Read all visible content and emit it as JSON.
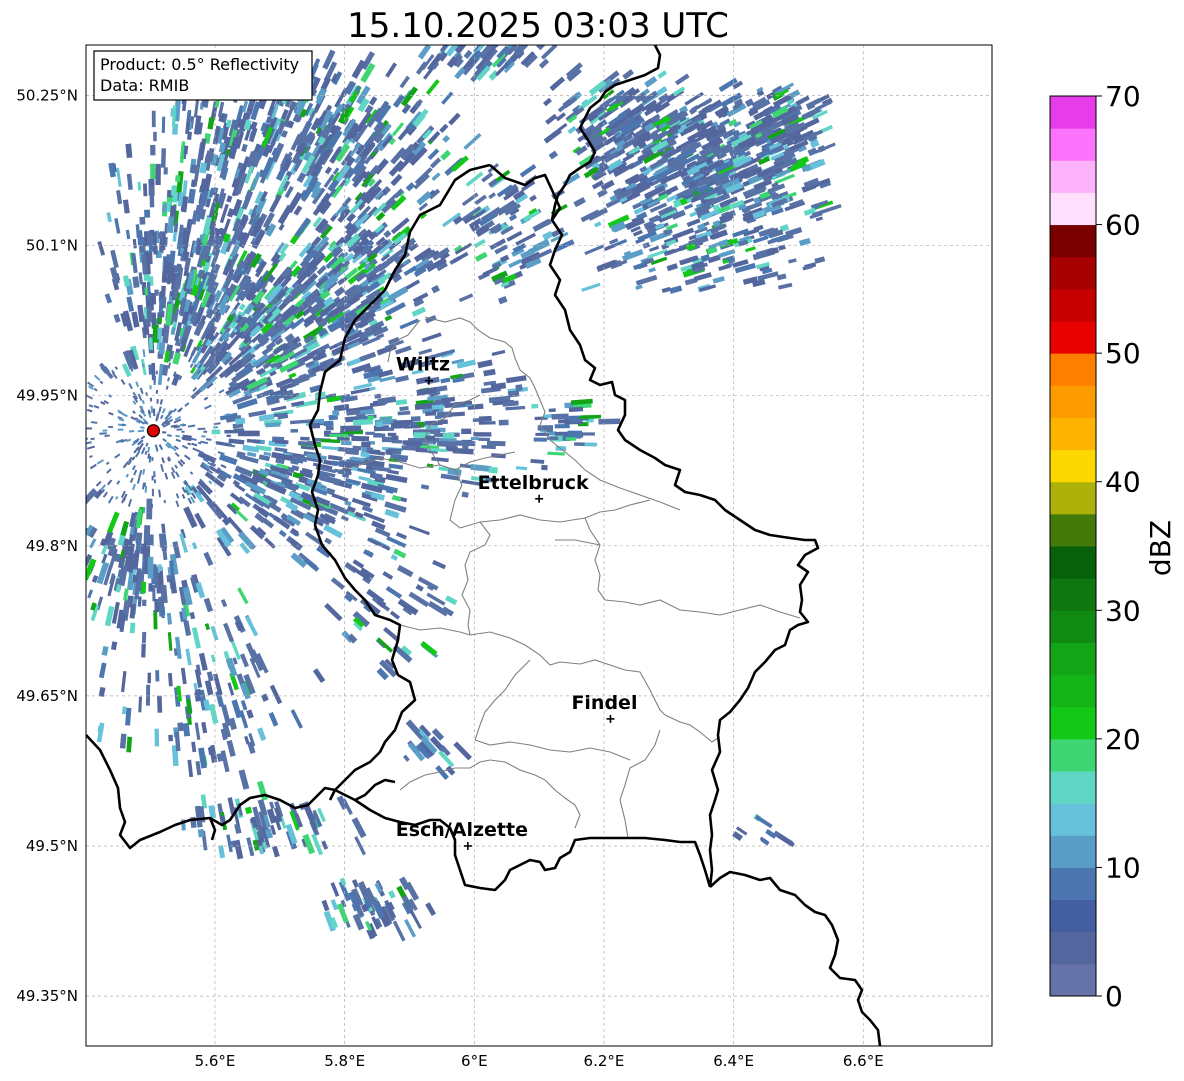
{
  "title": "15.10.2025 03:03 UTC",
  "info_box": {
    "line1": "Product: 0.5° Reflectivity",
    "line2": "Data: RMIB"
  },
  "lat_labels": [
    {
      "value": 50.25,
      "text": "50.25°N"
    },
    {
      "value": 50.1,
      "text": "50.1°N"
    },
    {
      "value": 49.95,
      "text": "49.95°N"
    },
    {
      "value": 49.8,
      "text": "49.8°N"
    },
    {
      "value": 49.65,
      "text": "49.65°N"
    },
    {
      "value": 49.5,
      "text": "49.5°N"
    },
    {
      "value": 49.35,
      "text": "49.35°N"
    }
  ],
  "lon_labels": [
    {
      "value": 5.6,
      "text": "5.6°E"
    },
    {
      "value": 5.8,
      "text": "5.8°E"
    },
    {
      "value": 6.0,
      "text": "6°E"
    },
    {
      "value": 6.2,
      "text": "6.2°E"
    },
    {
      "value": 6.4,
      "text": "6.4°E"
    },
    {
      "value": 6.6,
      "text": "6.6°E"
    }
  ],
  "cities": [
    {
      "name": "Wiltz",
      "lon": 5.93,
      "lat": 49.965
    },
    {
      "name": "Ettelbruck",
      "lon": 6.1,
      "lat": 49.847
    },
    {
      "name": "Findel",
      "lon": 6.21,
      "lat": 49.627
    },
    {
      "name": "Esch/Alzette",
      "lon": 5.99,
      "lat": 49.5
    }
  ],
  "radar_site": {
    "lon": 5.505,
    "lat": 49.915
  },
  "colorbar": {
    "label": "dBZ",
    "min": 0,
    "max": 70,
    "ticks": [
      {
        "v": 0,
        "t": "0"
      },
      {
        "v": 10,
        "t": "10"
      },
      {
        "v": 20,
        "t": "20"
      },
      {
        "v": 30,
        "t": "30"
      },
      {
        "v": 40,
        "t": "40"
      },
      {
        "v": 50,
        "t": "50"
      },
      {
        "v": 60,
        "t": "60"
      },
      {
        "v": 70,
        "t": "70"
      }
    ],
    "colors": [
      "#6673a8",
      "#53669e",
      "#435ea1",
      "#4b76af",
      "#5a9dc6",
      "#66c1da",
      "#60d6c4",
      "#3dd673",
      "#13c817",
      "#13b417",
      "#13a517",
      "#118a13",
      "#0f7610",
      "#09600b",
      "#437a0a",
      "#adb20a",
      "#fdd700",
      "#fcb400",
      "#fc9c00",
      "#fd7f00",
      "#e60000",
      "#c60000",
      "#a60000",
      "#7a0000",
      "#ffe0fc",
      "#fdb3fc",
      "#fc74fc",
      "#e73ce9"
    ]
  }
}
